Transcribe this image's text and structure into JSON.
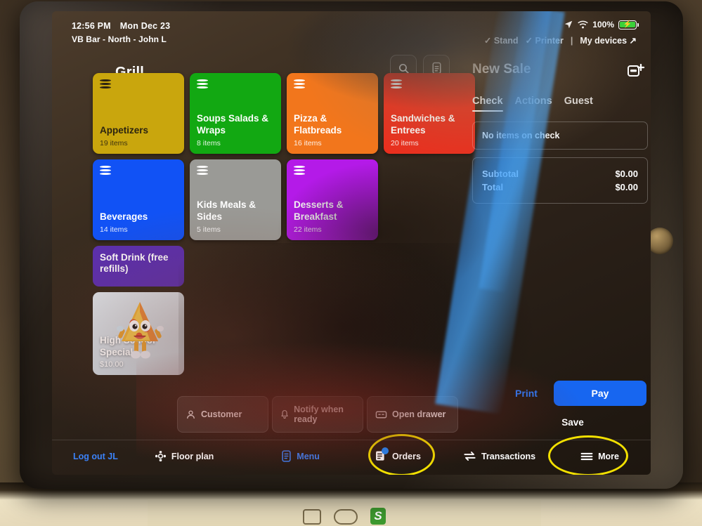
{
  "statusbar": {
    "time": "12:56 PM",
    "date": "Mon Dec 23",
    "location": "VB Bar - North - John L",
    "battery_percent": "100%",
    "devices": {
      "stand": "Stand",
      "printer": "Printer",
      "separator": "|",
      "my_devices": "My devices"
    }
  },
  "left_panel": {
    "title": "Grill",
    "search_icon": "search-icon",
    "notes_icon": "notes-icon",
    "categories": [
      {
        "name": "Appetizers",
        "count": "19 items",
        "color": "#c9a60d",
        "text": "dark"
      },
      {
        "name": "Soups Salads & Wraps",
        "count": "8 items",
        "color": "#12a812",
        "text": "light"
      },
      {
        "name": "Pizza & Flatbreads",
        "count": "16 items",
        "color": "#f2761c",
        "text": "light"
      },
      {
        "name": "Sandwiches & Entrees",
        "count": "20 items",
        "color": "#ea2f1e",
        "text": "light"
      },
      {
        "name": "Beverages",
        "count": "14 items",
        "color": "#1152f5",
        "text": "light"
      },
      {
        "name": "Kids Meals & Sides",
        "count": "5 items",
        "color": "#9a9a96",
        "text": "light"
      },
      {
        "name": "Desserts & Breakfast",
        "count": "22 items",
        "color": "#b41ae8",
        "text": "light"
      }
    ],
    "wide_tile": {
      "name": "Soft Drink (free refills)",
      "color": "#5b2fb0"
    },
    "item_tile": {
      "name": "High School Special",
      "price": "$10.00",
      "image": "pizza-mascot-image"
    }
  },
  "right_panel": {
    "title": "New Sale",
    "new_check_icon": "new-check-icon",
    "tabs": [
      {
        "label": "Check",
        "active": true
      },
      {
        "label": "Actions",
        "active": false
      },
      {
        "label": "Guest",
        "active": false
      }
    ],
    "empty_message": "No items on check",
    "totals": [
      {
        "label": "Subtotal",
        "value": "$0.00"
      },
      {
        "label": "Total",
        "value": "$0.00"
      }
    ],
    "print_label": "Print",
    "pay_label": "Pay",
    "save_label": "Save",
    "accent_color": "#1766f0"
  },
  "action_buttons": [
    {
      "label": "Customer",
      "icon": "person-icon"
    },
    {
      "label": "Notify when ready",
      "icon": "bell-icon"
    },
    {
      "label": "Open drawer",
      "icon": "cash-drawer-icon"
    }
  ],
  "bottom_nav": [
    {
      "label": "Log out JL",
      "icon": "logout-icon",
      "style": "blue",
      "badge": false
    },
    {
      "label": "Floor plan",
      "icon": "floor-plan-icon",
      "style": "white",
      "badge": false
    },
    {
      "label": "Menu",
      "icon": "menu-board-icon",
      "style": "blue",
      "badge": false
    },
    {
      "label": "Orders",
      "icon": "orders-icon",
      "style": "white",
      "badge": true
    },
    {
      "label": "Transactions",
      "icon": "transactions-icon",
      "style": "white",
      "badge": false
    },
    {
      "label": "More",
      "icon": "hamburger-icon",
      "style": "white",
      "badge": false
    }
  ],
  "annotations": {
    "highlight_color": "#f2e000",
    "circled": [
      "Orders",
      "More"
    ]
  }
}
